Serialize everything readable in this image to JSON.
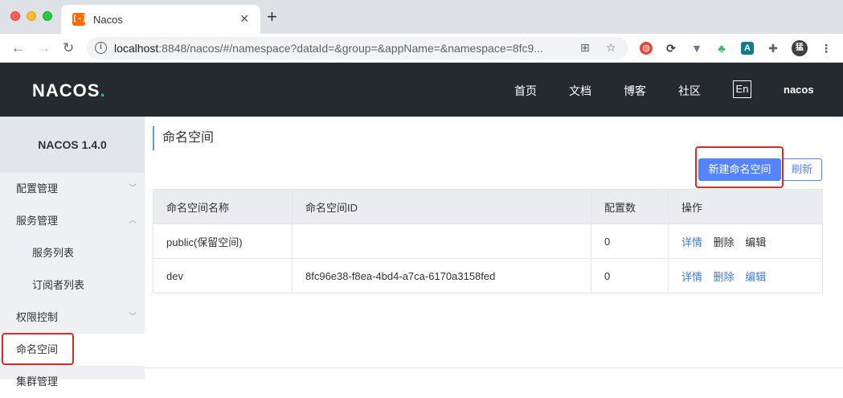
{
  "browser": {
    "tab_title": "Nacos",
    "favicon": "[-]",
    "new_tab_label": "+",
    "url_host": "localhost",
    "url_path": ":8848/nacos/#/namespace?dataId=&group=&appName=&namespace=8fc9...",
    "profile_initial": "猛"
  },
  "header": {
    "logo": "NACOS",
    "logo_dot": ".",
    "nav": [
      "首页",
      "文档",
      "博客",
      "社区"
    ],
    "lang": "En",
    "user": "nacos"
  },
  "sidebar": {
    "title": "NACOS 1.4.0",
    "items": [
      {
        "label": "配置管理",
        "chevron": "﹀"
      },
      {
        "label": "服务管理",
        "chevron": "︿"
      },
      {
        "label": "服务列表"
      },
      {
        "label": "订阅者列表"
      },
      {
        "label": "权限控制",
        "chevron": "﹀"
      },
      {
        "label": "命名空间"
      },
      {
        "label": "集群管理"
      }
    ]
  },
  "main": {
    "title": "命名空间",
    "create_button": "新建命名空间",
    "refresh_button": "刷新",
    "columns": [
      "命名空间名称",
      "命名空间ID",
      "配置数",
      "操作"
    ],
    "rows": [
      {
        "name": "public(保留空间)",
        "id": "",
        "count": "0",
        "actions": [
          "详情",
          "删除",
          "编辑"
        ]
      },
      {
        "name": "dev",
        "id": "8fc96e38-f8ea-4bd4-a7ca-6170a3158fed",
        "count": "0",
        "actions": [
          "详情",
          "删除",
          "编辑"
        ]
      }
    ]
  },
  "colors": {
    "header_bg": "#252a2f",
    "accent": "#5584ff",
    "highlight": "#e0282c"
  }
}
